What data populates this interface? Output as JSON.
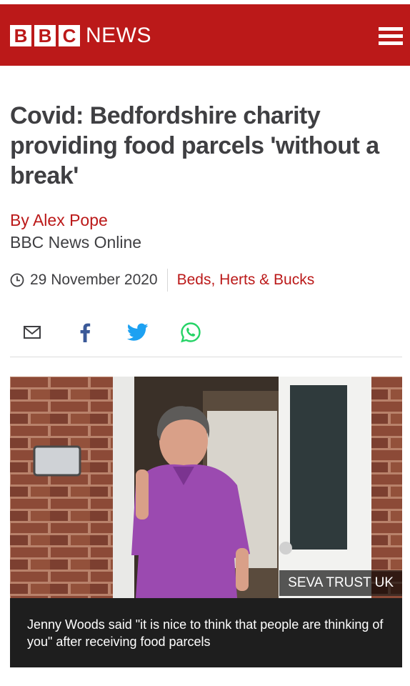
{
  "header": {
    "logo_letters": [
      "B",
      "B",
      "C"
    ],
    "logo_word": "NEWS",
    "brand_color": "#bb1919",
    "menu_icon": "hamburger-menu-icon"
  },
  "article": {
    "headline": "Covid: Bedfordshire charity providing food parcels 'without a break'",
    "author": "By Alex Pope",
    "organisation": "BBC News Online",
    "date": "29 November 2020",
    "section": "Beds, Herts & Bucks"
  },
  "share": {
    "icons": [
      "email-icon",
      "facebook-icon",
      "twitter-icon",
      "whatsapp-icon"
    ]
  },
  "image": {
    "credit": "SEVA TRUST UK",
    "caption": "Jenny Woods said \"it is nice to think that people are thinking of you\" after receiving food parcels"
  }
}
